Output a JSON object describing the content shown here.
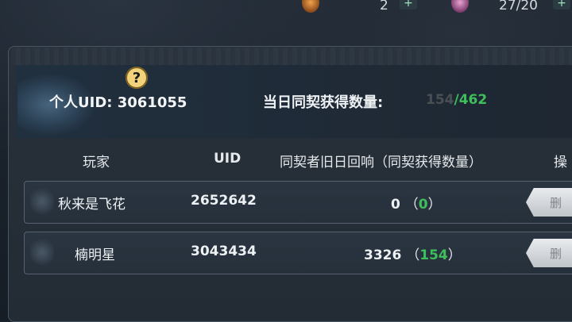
{
  "hud": {
    "count1": "2",
    "count2": "27/20"
  },
  "info": {
    "uid_label": "个人UID: 3061055",
    "daily_label": "当日同契获得数量:",
    "daily_current": "154",
    "daily_sep": "/",
    "daily_total": "462"
  },
  "table": {
    "headers": {
      "player": "玩家",
      "uid": "UID",
      "response": "同契者旧日回响（同契获得数量）",
      "operation": "操"
    },
    "rows": [
      {
        "name": "秋来是飞花",
        "uid": "2652642",
        "echo": "0",
        "gain": "0",
        "delete_label": "删"
      },
      {
        "name": "楠明星",
        "uid": "3043434",
        "echo": "3326",
        "gain": "154",
        "delete_label": "删"
      }
    ]
  },
  "colors": {
    "accent_green": "#3fbf5b",
    "help_yellow": "#f2d27a"
  },
  "icons": {
    "help": "question-mark-icon",
    "currency1": "orange-gem-icon",
    "currency2": "pink-gem-icon",
    "add": "plus-icon"
  }
}
